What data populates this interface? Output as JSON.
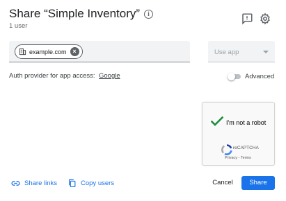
{
  "dialog": {
    "title": "Share “Simple Inventory”",
    "info_icon": "info-icon",
    "subtitle": "1 user",
    "header_icons": [
      "feedback-icon",
      "gear-icon"
    ]
  },
  "share_field": {
    "chip_label": "example.com",
    "chip_icon": "building-icon",
    "chip_remove_icon": "close-circle-icon"
  },
  "role_select": {
    "placeholder": "Use app"
  },
  "auth": {
    "label": "Auth provider for app access:",
    "provider": "Google"
  },
  "advanced": {
    "label": "Advanced",
    "enabled": false
  },
  "recaptcha": {
    "checkbox_label": "I'm not a robot",
    "brand": "reCAPTCHA",
    "privacy": "Privacy",
    "separator": " - ",
    "terms": "Terms",
    "checked": true,
    "check_color": "#1e8e3e"
  },
  "footer": {
    "share_links": "Share links",
    "copy_users": "Copy users",
    "cancel": "Cancel",
    "share": "Share"
  },
  "colors": {
    "accent": "#1a73e8",
    "text": "#202124",
    "muted": "#5f6368"
  }
}
